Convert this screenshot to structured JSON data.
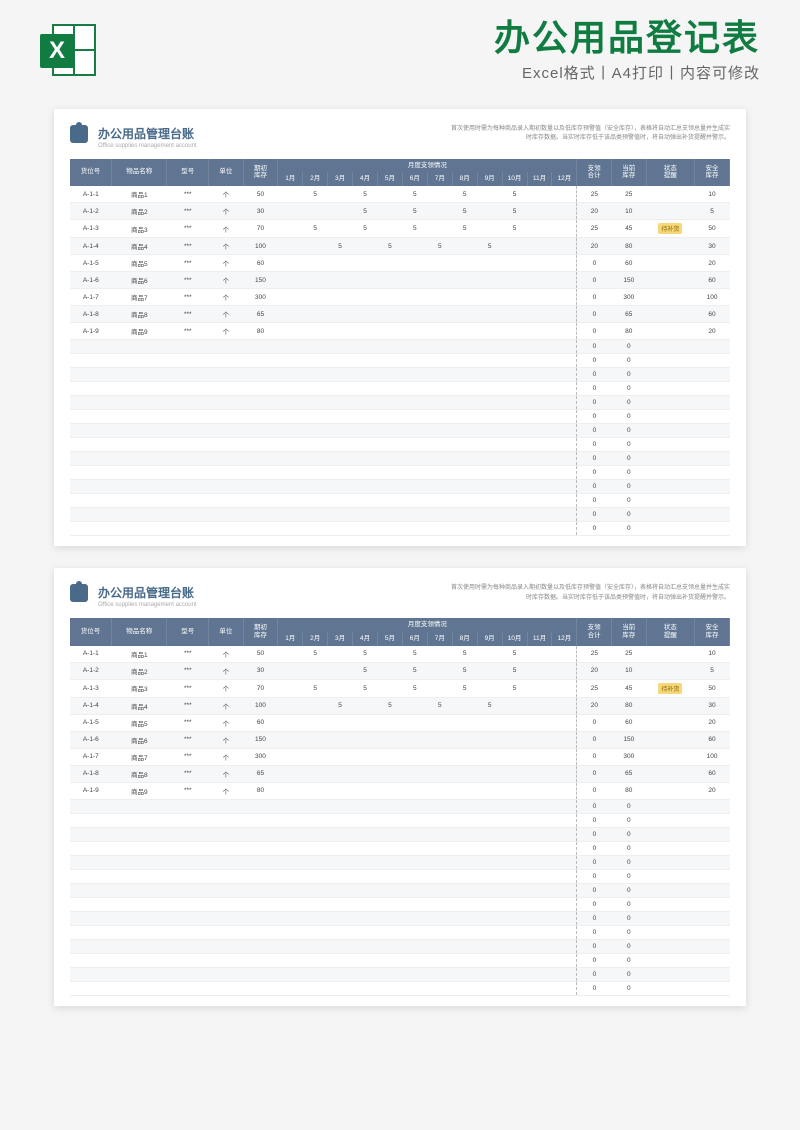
{
  "banner": {
    "title": "办公用品登记表",
    "subtitle": "Excel格式丨A4打印丨内容可修改",
    "icon_letter": "X"
  },
  "sheet": {
    "title": "办公用品管理台账",
    "subtitle": "Office supplies management account",
    "note": "首次使用时需为每种商品录入期初数量以及低库存预警值（安全库存），表格将自动汇总支领总量并生成实时库存数据。当实时库存低于该品类预警值时，将自动弹出补货提醒并警示。",
    "headers": {
      "slot": "货位号",
      "name": "物品名称",
      "model": "型号",
      "unit": "单位",
      "opening": "期初\n库存",
      "month_group": "月度支领情况",
      "months": [
        "1月",
        "2月",
        "3月",
        "4月",
        "5月",
        "6月",
        "7月",
        "8月",
        "9月",
        "10月",
        "11月",
        "12月"
      ],
      "total": "支领\n合计",
      "current": "当前\n库存",
      "status": "状态\n提醒",
      "safe": "安全\n库存"
    },
    "rows": [
      {
        "slot": "A-1-1",
        "name": "商品1",
        "model": "***",
        "unit": "个",
        "open": "50",
        "m": [
          "",
          "5",
          "",
          "5",
          "",
          "5",
          "",
          "5",
          "",
          "5",
          "",
          ""
        ],
        "total": "25",
        "cur": "25",
        "status": "",
        "safe": "10"
      },
      {
        "slot": "A-1-2",
        "name": "商品2",
        "model": "***",
        "unit": "个",
        "open": "30",
        "m": [
          "",
          "",
          "",
          "5",
          "",
          "5",
          "",
          "5",
          "",
          "5",
          "",
          ""
        ],
        "total": "20",
        "cur": "10",
        "status": "",
        "safe": "5"
      },
      {
        "slot": "A-1-3",
        "name": "商品3",
        "model": "***",
        "unit": "个",
        "open": "70",
        "m": [
          "",
          "5",
          "",
          "5",
          "",
          "5",
          "",
          "5",
          "",
          "5",
          "",
          ""
        ],
        "total": "25",
        "cur": "45",
        "status": "待补货",
        "safe": "50"
      },
      {
        "slot": "A-1-4",
        "name": "商品4",
        "model": "***",
        "unit": "个",
        "open": "100",
        "m": [
          "",
          "",
          "5",
          "",
          "5",
          "",
          "5",
          "",
          "5",
          "",
          "",
          ""
        ],
        "total": "20",
        "cur": "80",
        "status": "",
        "safe": "30"
      },
      {
        "slot": "A-1-5",
        "name": "商品5",
        "model": "***",
        "unit": "个",
        "open": "60",
        "m": [
          "",
          "",
          "",
          "",
          "",
          "",
          "",
          "",
          "",
          "",
          "",
          ""
        ],
        "total": "0",
        "cur": "60",
        "status": "",
        "safe": "20"
      },
      {
        "slot": "A-1-6",
        "name": "商品6",
        "model": "***",
        "unit": "个",
        "open": "150",
        "m": [
          "",
          "",
          "",
          "",
          "",
          "",
          "",
          "",
          "",
          "",
          "",
          ""
        ],
        "total": "0",
        "cur": "150",
        "status": "",
        "safe": "60"
      },
      {
        "slot": "A-1-7",
        "name": "商品7",
        "model": "***",
        "unit": "个",
        "open": "300",
        "m": [
          "",
          "",
          "",
          "",
          "",
          "",
          "",
          "",
          "",
          "",
          "",
          ""
        ],
        "total": "0",
        "cur": "300",
        "status": "",
        "safe": "100"
      },
      {
        "slot": "A-1-8",
        "name": "商品8",
        "model": "***",
        "unit": "个",
        "open": "65",
        "m": [
          "",
          "",
          "",
          "",
          "",
          "",
          "",
          "",
          "",
          "",
          "",
          ""
        ],
        "total": "0",
        "cur": "65",
        "status": "",
        "safe": "60"
      },
      {
        "slot": "A-1-9",
        "name": "商品9",
        "model": "***",
        "unit": "个",
        "open": "80",
        "m": [
          "",
          "",
          "",
          "",
          "",
          "",
          "",
          "",
          "",
          "",
          "",
          ""
        ],
        "total": "0",
        "cur": "80",
        "status": "",
        "safe": "20"
      }
    ],
    "empty_row_count": 14
  }
}
